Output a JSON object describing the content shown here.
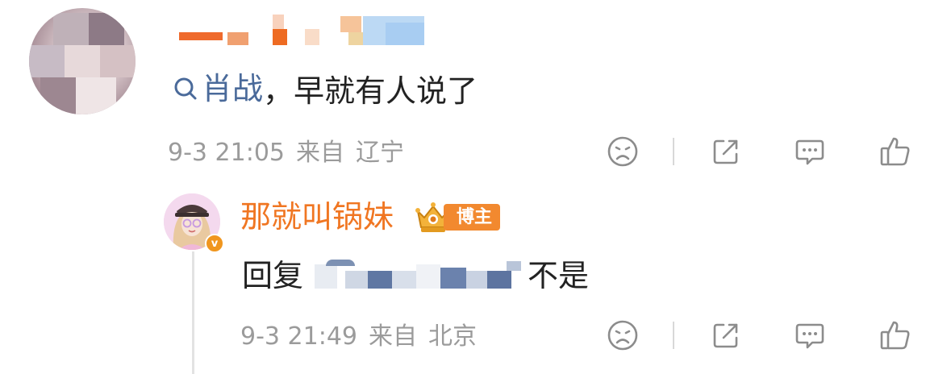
{
  "comment": {
    "topic": "肖战",
    "text": "，早就有人说了",
    "date": "9-3 21:05",
    "source_prefix": "来自",
    "location": "辽宁",
    "icons": [
      "sad-emoji-icon",
      "share-icon",
      "comment-icon",
      "like-icon"
    ]
  },
  "reply": {
    "author": "那就叫锅妹",
    "badge": "博主",
    "verified_mark": "v",
    "reply_prefix": "回复",
    "text_tail": "不是",
    "date": "9-3 21:49",
    "source_prefix": "来自",
    "location": "北京",
    "icons": [
      "sad-emoji-icon",
      "share-icon",
      "comment-icon",
      "like-icon"
    ]
  },
  "colors": {
    "link": "#4a6a9a",
    "author": "#f07622",
    "badge": "#f2892f",
    "meta": "#9b9b9b",
    "text": "#222222"
  }
}
